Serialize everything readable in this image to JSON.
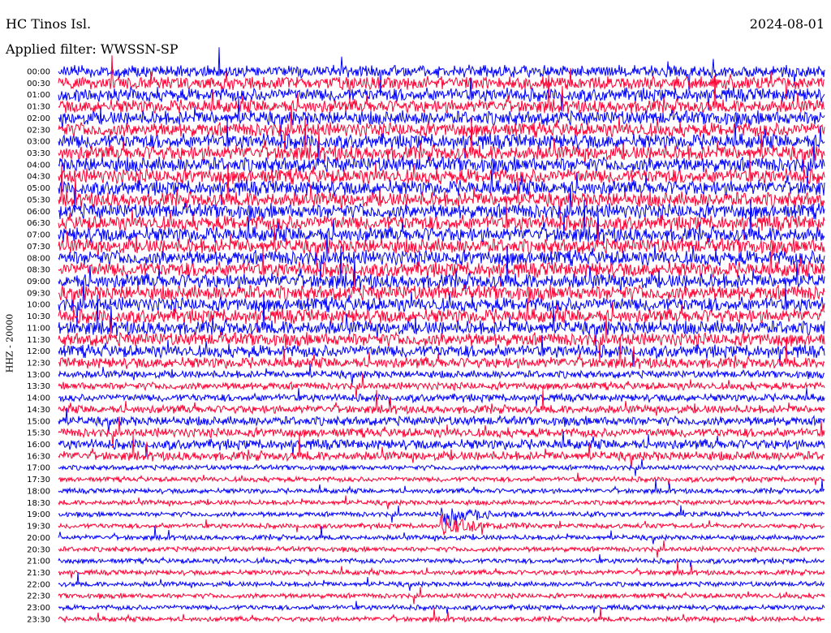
{
  "header": {
    "station": "HC Tinos Isl.",
    "date": "2024-08-01",
    "filter": "Applied filter: WWSSN-SP"
  },
  "channel_label": "HHZ - 20000",
  "colors": {
    "trace_a": "#0000ff",
    "trace_b": "#ff0033",
    "background": "#ffffff"
  },
  "chart_data": {
    "type": "line",
    "title": "HC Tinos Isl.",
    "subtitle": "Applied filter: WWSSN-SP",
    "date": "2024-08-01",
    "ylabel": "HHZ - 20000",
    "xlabel": "",
    "row_labels": [
      "00:00",
      "00:30",
      "01:00",
      "01:30",
      "02:00",
      "02:30",
      "03:00",
      "03:30",
      "04:00",
      "04:30",
      "05:00",
      "05:30",
      "06:00",
      "06:30",
      "07:00",
      "07:30",
      "08:00",
      "08:30",
      "09:00",
      "09:30",
      "10:00",
      "10:30",
      "11:00",
      "11:30",
      "12:00",
      "12:30",
      "13:00",
      "13:30",
      "14:00",
      "14:30",
      "15:00",
      "15:30",
      "16:00",
      "16:30",
      "17:00",
      "17:30",
      "18:00",
      "18:30",
      "19:00",
      "19:30",
      "20:00",
      "20:30",
      "21:00",
      "21:30",
      "22:00",
      "22:30",
      "23:00",
      "23:30"
    ],
    "trace_colors": [
      "#0000ff",
      "#ff0033"
    ],
    "relative_noise_amplitude": [
      1.4,
      1.5,
      1.6,
      1.6,
      1.7,
      1.7,
      1.8,
      1.8,
      1.8,
      1.8,
      1.8,
      1.8,
      1.8,
      1.8,
      1.8,
      1.8,
      1.8,
      1.8,
      1.8,
      1.8,
      1.7,
      1.7,
      1.7,
      1.6,
      1.5,
      1.3,
      0.9,
      0.9,
      0.9,
      1.0,
      1.1,
      1.1,
      1.2,
      1.1,
      0.6,
      0.6,
      0.6,
      0.6,
      0.6,
      0.6,
      0.6,
      0.6,
      0.6,
      0.6,
      0.6,
      0.6,
      0.6,
      0.6
    ],
    "events": [
      {
        "row": "19:00",
        "description": "earthquake arrival",
        "relative_amplitude": 3.0
      },
      {
        "row": "19:30",
        "description": "earthquake coda",
        "relative_amplitude": 2.2
      }
    ],
    "grid": false,
    "legend": "none"
  }
}
